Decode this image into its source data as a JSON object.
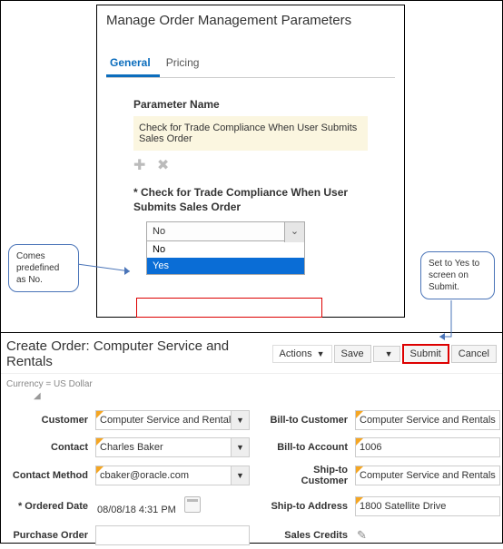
{
  "top": {
    "title": "Manage Order Management Parameters",
    "tabs": [
      {
        "label": "General",
        "active": true
      },
      {
        "label": "Pricing",
        "active": false
      }
    ],
    "param_header": "Parameter Name",
    "param_row": "Check for Trade Compliance When User Submits Sales Order",
    "field_label": "Check for Trade Compliance When User Submits Sales Order",
    "select": {
      "value": "No",
      "options": [
        "No",
        "Yes"
      ],
      "highlighted": "Yes"
    }
  },
  "callouts": {
    "left": "Comes predefined as No.",
    "right": "Set to Yes to screen on Submit."
  },
  "bottom": {
    "title": "Create Order: Computer Service and Rentals",
    "buttons": {
      "actions": "Actions",
      "save": "Save",
      "submit": "Submit",
      "cancel": "Cancel"
    },
    "currency": "Currency = US Dollar",
    "fields": {
      "customer_label": "Customer",
      "customer_value": "Computer Service and Rentals",
      "contact_label": "Contact",
      "contact_value": "Charles Baker",
      "contact_method_label": "Contact Method",
      "contact_method_value": "cbaker@oracle.com",
      "ordered_date_label": "Ordered Date",
      "ordered_date_value": "08/08/18 4:31 PM",
      "purchase_order_label": "Purchase Order",
      "purchase_order_value": "",
      "bill_to_customer_label": "Bill-to Customer",
      "bill_to_customer_value": "Computer Service and Rentals",
      "bill_to_account_label": "Bill-to Account",
      "bill_to_account_value": "1006",
      "ship_to_customer_label": "Ship-to Customer",
      "ship_to_customer_value": "Computer Service and Rentals",
      "ship_to_address_label": "Ship-to Address",
      "ship_to_address_value": "1800 Satellite Drive",
      "sales_credits_label": "Sales Credits"
    }
  }
}
